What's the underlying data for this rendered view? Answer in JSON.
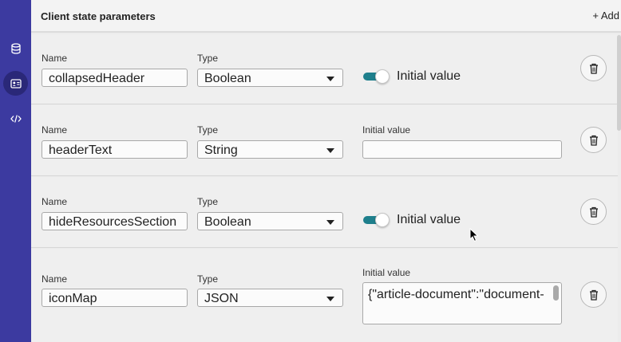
{
  "sidebar": {
    "icons": [
      {
        "name": "database-icon",
        "active": false
      },
      {
        "name": "contact-card-icon",
        "active": true
      },
      {
        "name": "code-icon",
        "active": false
      }
    ]
  },
  "header": {
    "title": "Client state parameters",
    "add_label": "+ Add"
  },
  "labels": {
    "name": "Name",
    "type": "Type",
    "initial_value": "Initial value"
  },
  "params": [
    {
      "name": "collapsedHeader",
      "type": "Boolean",
      "initial_value": true
    },
    {
      "name": "headerText",
      "type": "String",
      "initial_value": ""
    },
    {
      "name": "hideResourcesSection",
      "type": "Boolean",
      "initial_value": true
    },
    {
      "name": "iconMap",
      "type": "JSON",
      "initial_value": "{\"article-document\":\"document-"
    }
  ],
  "colors": {
    "rail": "#3c3aa0",
    "rail_active": "#2a2878",
    "toggle_on": "#1e7f8c"
  }
}
